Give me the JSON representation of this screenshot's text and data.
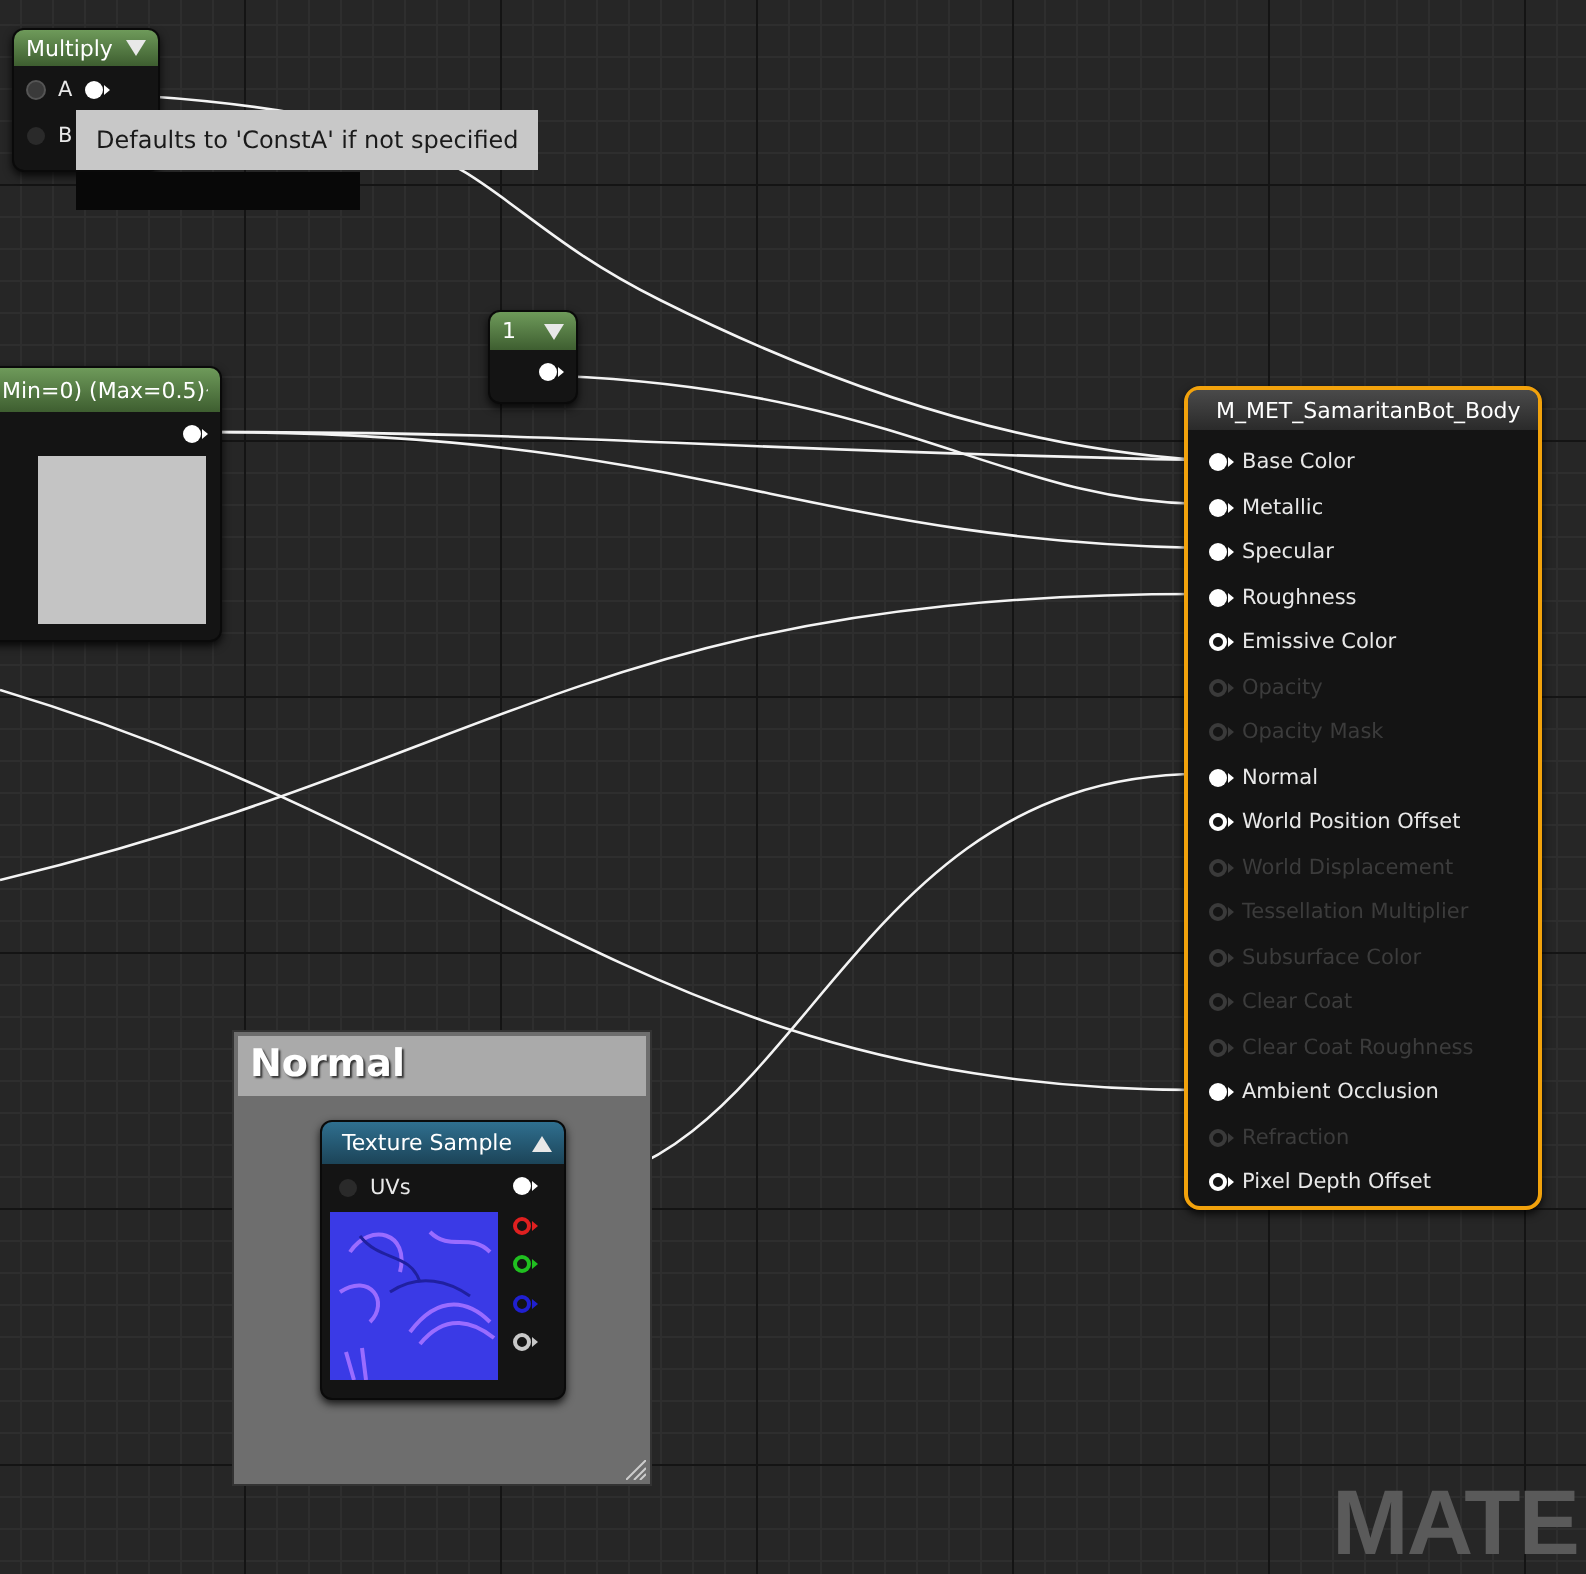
{
  "multiply_node": {
    "title": "Multiply",
    "inputs": [
      {
        "label": "A",
        "connected": true
      },
      {
        "label": "B",
        "connected": false
      }
    ]
  },
  "tooltip": {
    "text": "Defaults to 'ConstA' if not specified"
  },
  "texture_parameter_node": {
    "title": "Min=0) (Max=0.5)"
  },
  "constant_node": {
    "title": "1"
  },
  "material_node": {
    "title": "M_MET_SamaritanBot_Body",
    "selected": true,
    "inputs": [
      {
        "label": "Base Color",
        "connected": true,
        "enabled": true
      },
      {
        "label": "Metallic",
        "connected": true,
        "enabled": true
      },
      {
        "label": "Specular",
        "connected": true,
        "enabled": true
      },
      {
        "label": "Roughness",
        "connected": true,
        "enabled": true
      },
      {
        "label": "Emissive Color",
        "connected": false,
        "enabled": true
      },
      {
        "label": "Opacity",
        "connected": false,
        "enabled": false
      },
      {
        "label": "Opacity Mask",
        "connected": false,
        "enabled": false
      },
      {
        "label": "Normal",
        "connected": true,
        "enabled": true
      },
      {
        "label": "World Position Offset",
        "connected": false,
        "enabled": true
      },
      {
        "label": "World Displacement",
        "connected": false,
        "enabled": false
      },
      {
        "label": "Tessellation Multiplier",
        "connected": false,
        "enabled": false
      },
      {
        "label": "Subsurface Color",
        "connected": false,
        "enabled": false
      },
      {
        "label": "Clear Coat",
        "connected": false,
        "enabled": false
      },
      {
        "label": "Clear Coat Roughness",
        "connected": false,
        "enabled": false
      },
      {
        "label": "Ambient Occlusion",
        "connected": true,
        "enabled": true
      },
      {
        "label": "Refraction",
        "connected": false,
        "enabled": false
      },
      {
        "label": "Pixel Depth Offset",
        "connected": false,
        "enabled": true
      }
    ]
  },
  "comment": {
    "title": "Normal"
  },
  "texture_sample_node": {
    "title": "Texture Sample",
    "inputs": [
      {
        "label": "UVs",
        "connected": false
      }
    ],
    "outputs": [
      {
        "color": "#ffffff",
        "connected": true
      },
      {
        "color": "#e02020",
        "connected": false
      },
      {
        "color": "#20c020",
        "connected": false
      },
      {
        "color": "#2020d0",
        "connected": false
      },
      {
        "color": "#c8c8c8",
        "connected": false
      }
    ]
  },
  "graph_label": "MATE"
}
